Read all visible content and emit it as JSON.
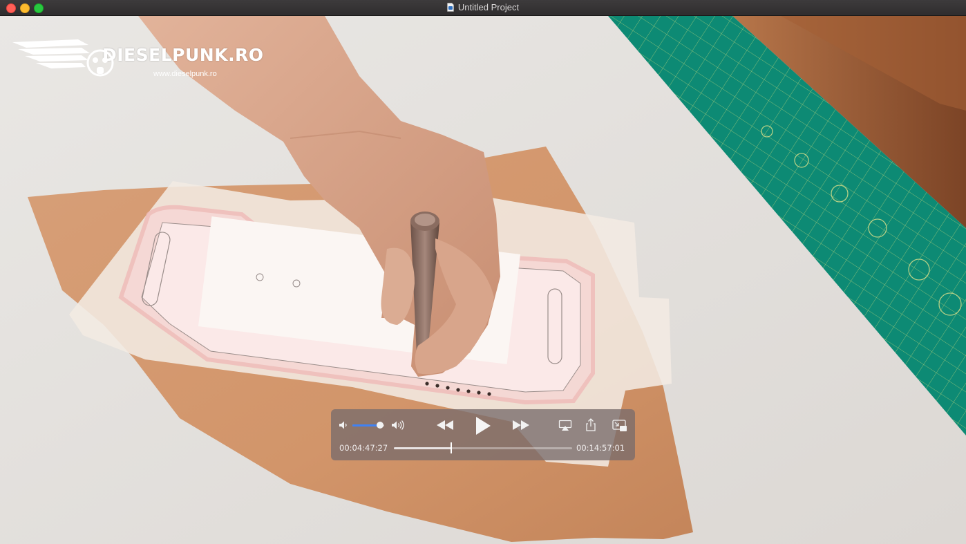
{
  "window": {
    "title": "Untitled Project"
  },
  "watermark": {
    "brand": "DIESELPUNK.RO",
    "url": "www.dieselpunk.ro"
  },
  "player": {
    "current_time": "00:04:47:27",
    "total_time": "00:14:57:01",
    "progress": 0.32,
    "volume": 0.88
  },
  "icons": {
    "volume_low": "speaker-low-icon",
    "volume_high": "speaker-high-icon",
    "rewind": "rewind-icon",
    "play": "play-icon",
    "fast_forward": "fast-forward-icon",
    "airplay": "airplay-icon",
    "share": "share-icon",
    "picture_in_picture": "picture-in-picture-icon"
  },
  "colors": {
    "accent": "#3f82f4",
    "cutting_mat": "#0d8a74"
  }
}
